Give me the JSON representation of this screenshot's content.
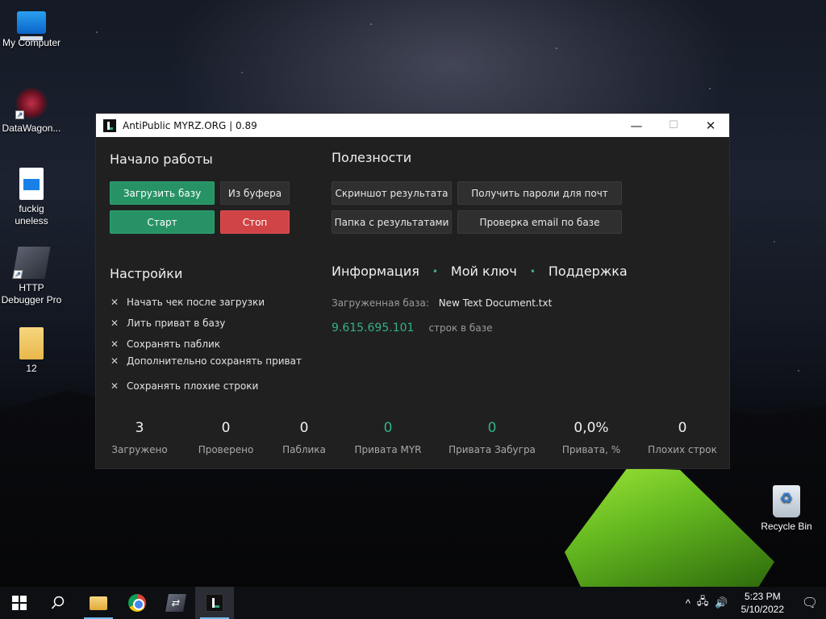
{
  "desktop": {
    "icons": [
      {
        "label": "My Computer",
        "icon": "computer-icon"
      },
      {
        "label": "DataWagon...",
        "icon": "datawagon-icon"
      },
      {
        "label": "fuckig uneless",
        "icon": "video-file-icon"
      },
      {
        "label": "HTTP Debugger Pro",
        "icon": "http-debugger-icon"
      },
      {
        "label": "12",
        "icon": "folder-icon"
      },
      {
        "label": "Recycle Bin",
        "icon": "recycle-bin-icon"
      }
    ]
  },
  "window": {
    "title": "AntiPublic MYRZ.ORG | 0.89",
    "controls": {
      "minimize": "—",
      "maximize": "☐",
      "close": "✕"
    }
  },
  "start": {
    "title": "Начало работы",
    "load_db": "Загрузить базу",
    "from_clipboard": "Из буфера",
    "start": "Старт",
    "stop": "Стоп"
  },
  "utilities": {
    "title": "Полезности",
    "screenshot": "Скриншот результата",
    "get_passwords": "Получить пароли для почт",
    "results_folder": "Папка с результатами",
    "check_email": "Проверка email по базе"
  },
  "settings": {
    "title": "Настройки",
    "items": [
      "Начать чек после загрузки",
      "Лить приват в базу",
      "Сохранять паблик",
      "Дополнительно сохранять приват",
      "Сохранять плохие строки"
    ],
    "mark": "✕"
  },
  "info": {
    "tabs": [
      "Информация",
      "Мой ключ",
      "Поддержка"
    ],
    "separator": "•",
    "loaded_db_label": "Загруженная база:",
    "loaded_db_value": "New Text Document.txt",
    "rows_count": "9.615.695.101",
    "rows_label": "строк в базе"
  },
  "stats": [
    {
      "value": "3",
      "label": "Загружено",
      "accent": false
    },
    {
      "value": "0",
      "label": "Проверено",
      "accent": false
    },
    {
      "value": "0",
      "label": "Паблика",
      "accent": false
    },
    {
      "value": "0",
      "label": "Привата MYR",
      "accent": true
    },
    {
      "value": "0",
      "label": "Привата Забугра",
      "accent": true
    },
    {
      "value": "0,0%",
      "label": "Привата, %",
      "accent": false
    },
    {
      "value": "0",
      "label": "Плохих строк",
      "accent": false
    }
  ],
  "taskbar": {
    "time": "5:23 PM",
    "date": "5/10/2022",
    "tray": {
      "chevron": "^",
      "network": "🖧",
      "volume": "🔊",
      "notifications": "🗨"
    }
  },
  "colors": {
    "green": "#279365",
    "red": "#d04446",
    "accent_text": "#34b283",
    "window_bg": "#202020"
  }
}
